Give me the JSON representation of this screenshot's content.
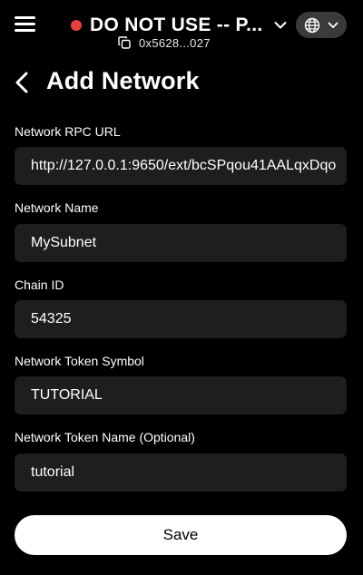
{
  "topbar": {
    "menu_icon": "hamburger-menu-icon",
    "account_name": "DO NOT USE -- P...",
    "account_status_color": "#e84142",
    "address": "0x5628...027",
    "language_icon": "globe-icon"
  },
  "header": {
    "title": "Add Network",
    "back_icon": "chevron-left-icon"
  },
  "form": {
    "rpc_url": {
      "label": "Network RPC URL",
      "value": "http://127.0.0.1:9650/ext/bcSPqou41AALqxDqo"
    },
    "network_name": {
      "label": "Network Name",
      "value": "MySubnet"
    },
    "chain_id": {
      "label": "Chain ID",
      "value": "54325"
    },
    "token_symbol": {
      "label": "Network Token Symbol",
      "value": "TUTORIAL"
    },
    "token_name": {
      "label": "Network Token Name (Optional)",
      "value": "tutorial"
    }
  },
  "actions": {
    "save_label": "Save"
  },
  "colors": {
    "background": "#000000",
    "input_background": "#1e1e1f",
    "button_background": "#ffffff",
    "pill_background": "#3a3a3c"
  }
}
